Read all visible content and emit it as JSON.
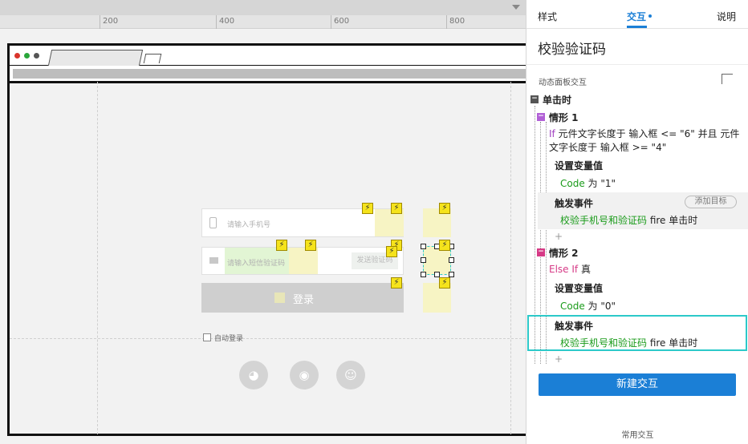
{
  "ruler": {
    "ticks": [
      "200",
      "400",
      "600",
      "800"
    ]
  },
  "form": {
    "phone_placeholder": "请输入手机号",
    "sms_placeholder": "请输入短信验证码",
    "send_code_label": "发送验证码",
    "login_label": "登录",
    "auto_login_label": "自动登录"
  },
  "panel": {
    "tabs": [
      "样式",
      "交互",
      "说明"
    ],
    "title": "校验验证码",
    "section_label": "动态面板交互",
    "event": "单击时",
    "case1": {
      "title": "情形 1",
      "cond_if": "If",
      "cond_line1": " 元件文字长度于 输入框 <= \"6\" 并且 元件",
      "cond_line2": "文字长度于 输入框 >= \"4\"",
      "action1_title": "设置变量值",
      "action1_var": "Code",
      "action1_value": " 为 \"1\"",
      "action2_title": "触发事件",
      "action2_target": "校验手机号和验证码",
      "action2_event": " fire 单击时",
      "add_target": "添加目标"
    },
    "case2": {
      "title": "情形 2",
      "cond_else": "Else If",
      "cond_rest": " 真",
      "action1_title": "设置变量值",
      "action1_var": "Code",
      "action1_value": " 为 \"0\"",
      "action2_title": "触发事件",
      "action2_target": "校验手机号和验证码",
      "action2_event": " fire 单击时"
    },
    "plus": "+",
    "new_interaction": "新建交互",
    "common_interactions": "常用交互"
  },
  "colors": {
    "accent": "#1b7fd6",
    "selection": "#2cc9c9",
    "green": "#1a9b1a",
    "pink": "#d63a86"
  }
}
